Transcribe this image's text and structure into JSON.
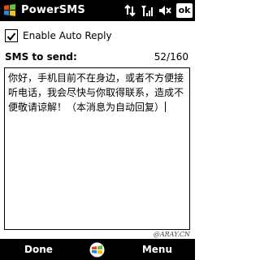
{
  "title_bar": {
    "app_title": "PowerSMS",
    "ok_label": "ok"
  },
  "settings": {
    "auto_reply_label": "Enable Auto Reply",
    "auto_reply_checked": true
  },
  "compose": {
    "label": "SMS to send:",
    "counter": "52/160",
    "message": "你好，手机目前不在身边，或者不方便接听电话，我会尽快与你取得联系，造成不便敬请谅解！（本消息为自动回复）"
  },
  "watermark": "@ARAY.CN",
  "softkeys": {
    "left": "Done",
    "right": "Menu"
  }
}
